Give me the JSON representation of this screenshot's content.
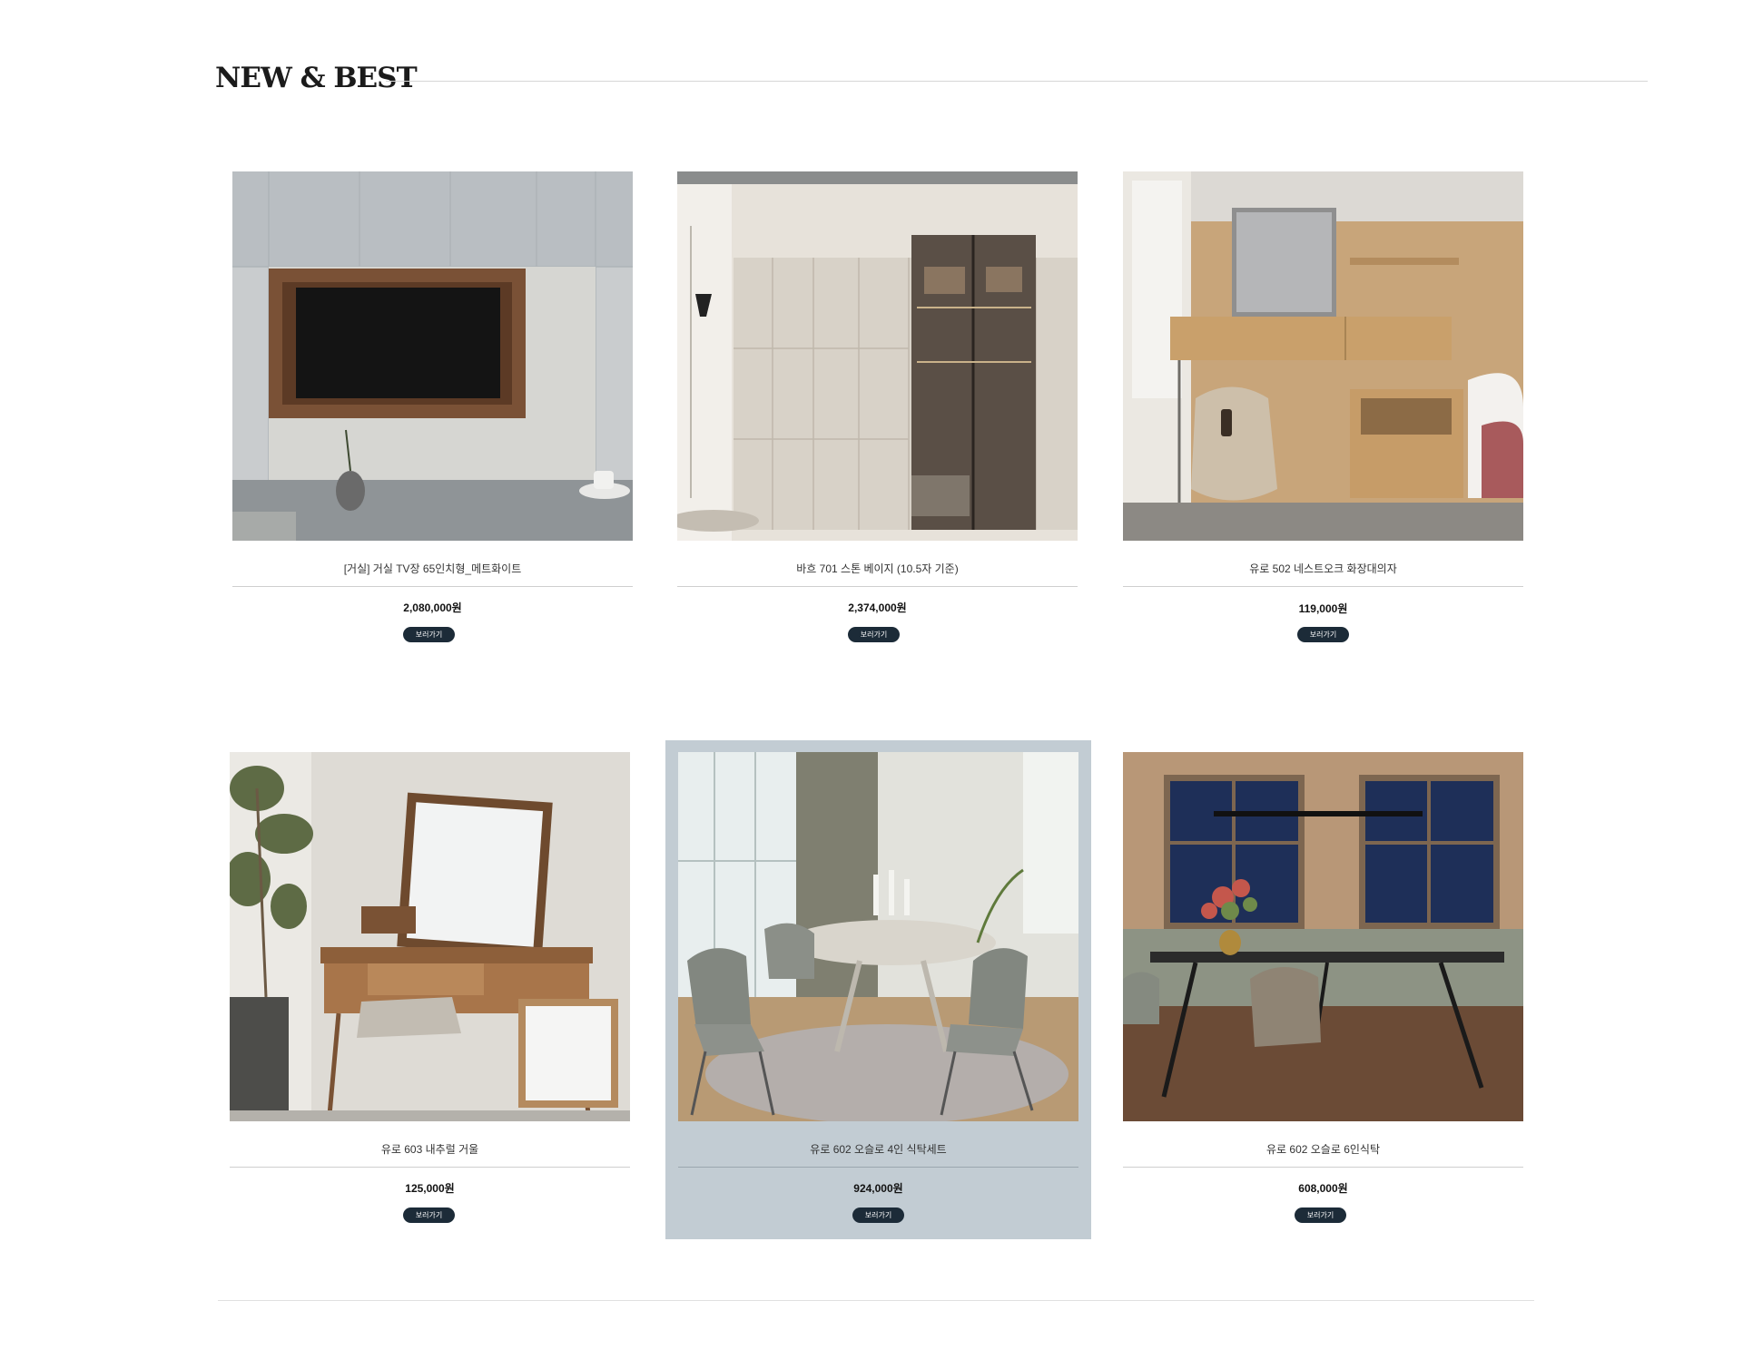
{
  "section": {
    "title": "NEW & BEST"
  },
  "colors": {
    "button_bg": "#1c2b38",
    "highlight_bg": "#c2ccd3",
    "rule": "#d6d6d6"
  },
  "products": [
    {
      "name": "[거실] 거실 TV장 65인치형_메트화이트",
      "price": "2,080,000원",
      "button": "보러가기",
      "image": "living-room-tv-cabinet-photo"
    },
    {
      "name": "바흐 701 스톤 베이지 (10.5자 기준)",
      "price": "2,374,000원",
      "button": "보러가기",
      "image": "wardrobe-stone-beige-photo"
    },
    {
      "name": "유로 502 네스트오크 화장대의자",
      "price": "119,000원",
      "button": "보러가기",
      "image": "vanity-stool-oak-photo"
    },
    {
      "name": "유로 603 내추럴 거울",
      "price": "125,000원",
      "button": "보러가기",
      "image": "vanity-mirror-natural-photo"
    },
    {
      "name": "유로 602 오슬로 4인 식탁세트",
      "price": "924,000원",
      "button": "보러가기",
      "image": "dining-set-4-person-photo"
    },
    {
      "name": "유로 602 오슬로 6인식탁",
      "price": "608,000원",
      "button": "보러가기",
      "image": "dining-table-6-person-photo"
    }
  ]
}
